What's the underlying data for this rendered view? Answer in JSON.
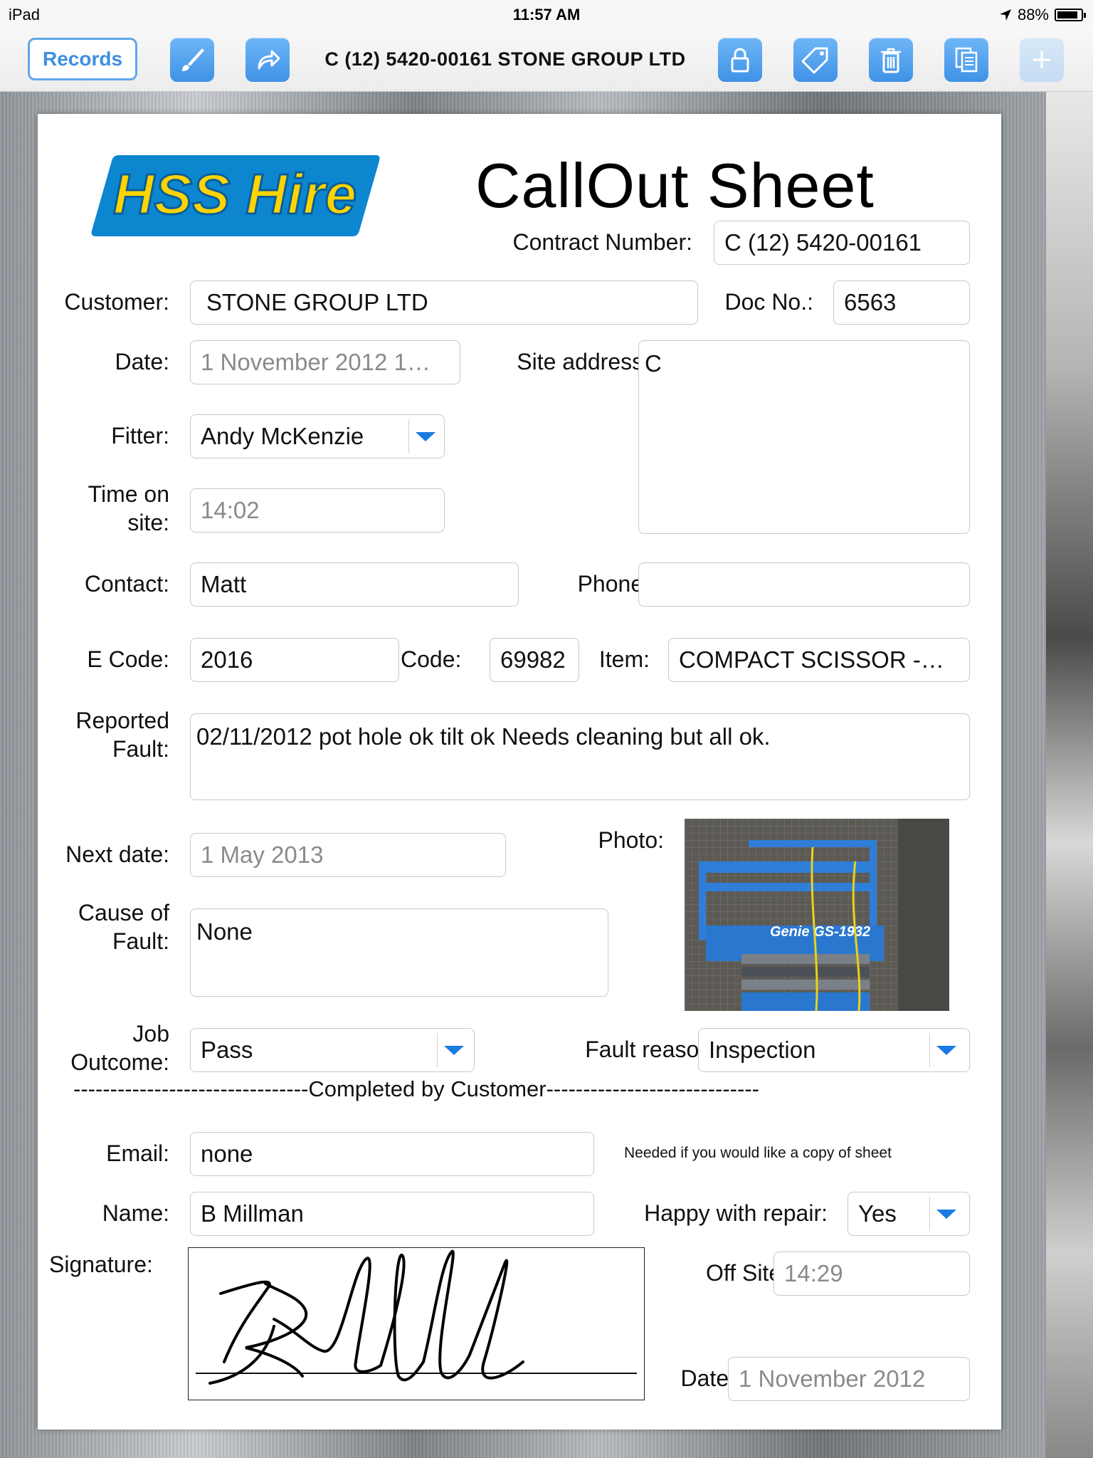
{
  "status_bar": {
    "device": "iPad",
    "time": "11:57 AM",
    "battery": "88%",
    "battery_level": 0.88
  },
  "toolbar": {
    "records_label": "Records",
    "title": "C (12) 5420-00161 STONE GROUP LTD",
    "icons": [
      "brush-icon",
      "share-arrow-icon",
      "lock-icon",
      "tag-icon",
      "trash-icon",
      "copy-icon",
      "plus-icon"
    ]
  },
  "logo": {
    "text": "HSS Hire"
  },
  "sheet_title": "CallOut Sheet",
  "form": {
    "contract_number_label": "Contract Number:",
    "contract_number": "C (12) 5420-00161",
    "customer_label": "Customer:",
    "customer": "STONE GROUP LTD",
    "doc_no_label": "Doc No.:",
    "doc_no": "6563",
    "date_label": "Date:",
    "date": "1 November 2012 1…",
    "site_address_label": "Site address:",
    "site_address": "C",
    "fitter_label": "Fitter:",
    "fitter": "Andy McKenzie",
    "time_on_site_label_1": "Time on",
    "time_on_site_label_2": "site:",
    "time_on_site": "14:02",
    "contact_label": "Contact:",
    "contact": "Matt",
    "phone_label": "Phone:",
    "phone": "",
    "e_code_label": "E Code:",
    "e_code": "2016",
    "code_label": "Code:",
    "code": "69982",
    "item_label": "Item:",
    "item": "COMPACT SCISSOR -…",
    "reported_fault_label_1": "Reported",
    "reported_fault_label_2": "Fault:",
    "reported_fault": "02/11/2012 pot hole ok tilt ok Needs cleaning but all ok.",
    "next_date_label": "Next date:",
    "next_date": "1 May 2013",
    "photo_label": "Photo:",
    "photo_caption": "Genie GS-1932",
    "cause_label_1": "Cause of",
    "cause_label_2": "Fault:",
    "cause_of_fault": "None",
    "job_outcome_label_1": "Job",
    "job_outcome_label_2": "Outcome:",
    "job_outcome": "Pass",
    "fault_reason_label": "Fault reason:",
    "fault_reason": "Inspection",
    "completed_divider": "--------------------------------Completed by Customer-----------------------------",
    "email_label": "Email:",
    "email": "none",
    "email_note": "Needed if you would like a copy of sheet",
    "name_label": "Name:",
    "name": "B Millman",
    "happy_label": "Happy with repair:",
    "happy": "Yes",
    "signature_label": "Signature:",
    "off_site_label": "Off Site:",
    "off_site": "14:29",
    "date2_label": "Date:",
    "date2": "1 November 2012"
  },
  "colors": {
    "accent": "#3d8fe0",
    "logo_blue": "#0d86d0",
    "logo_yellow": "#ffd400"
  }
}
